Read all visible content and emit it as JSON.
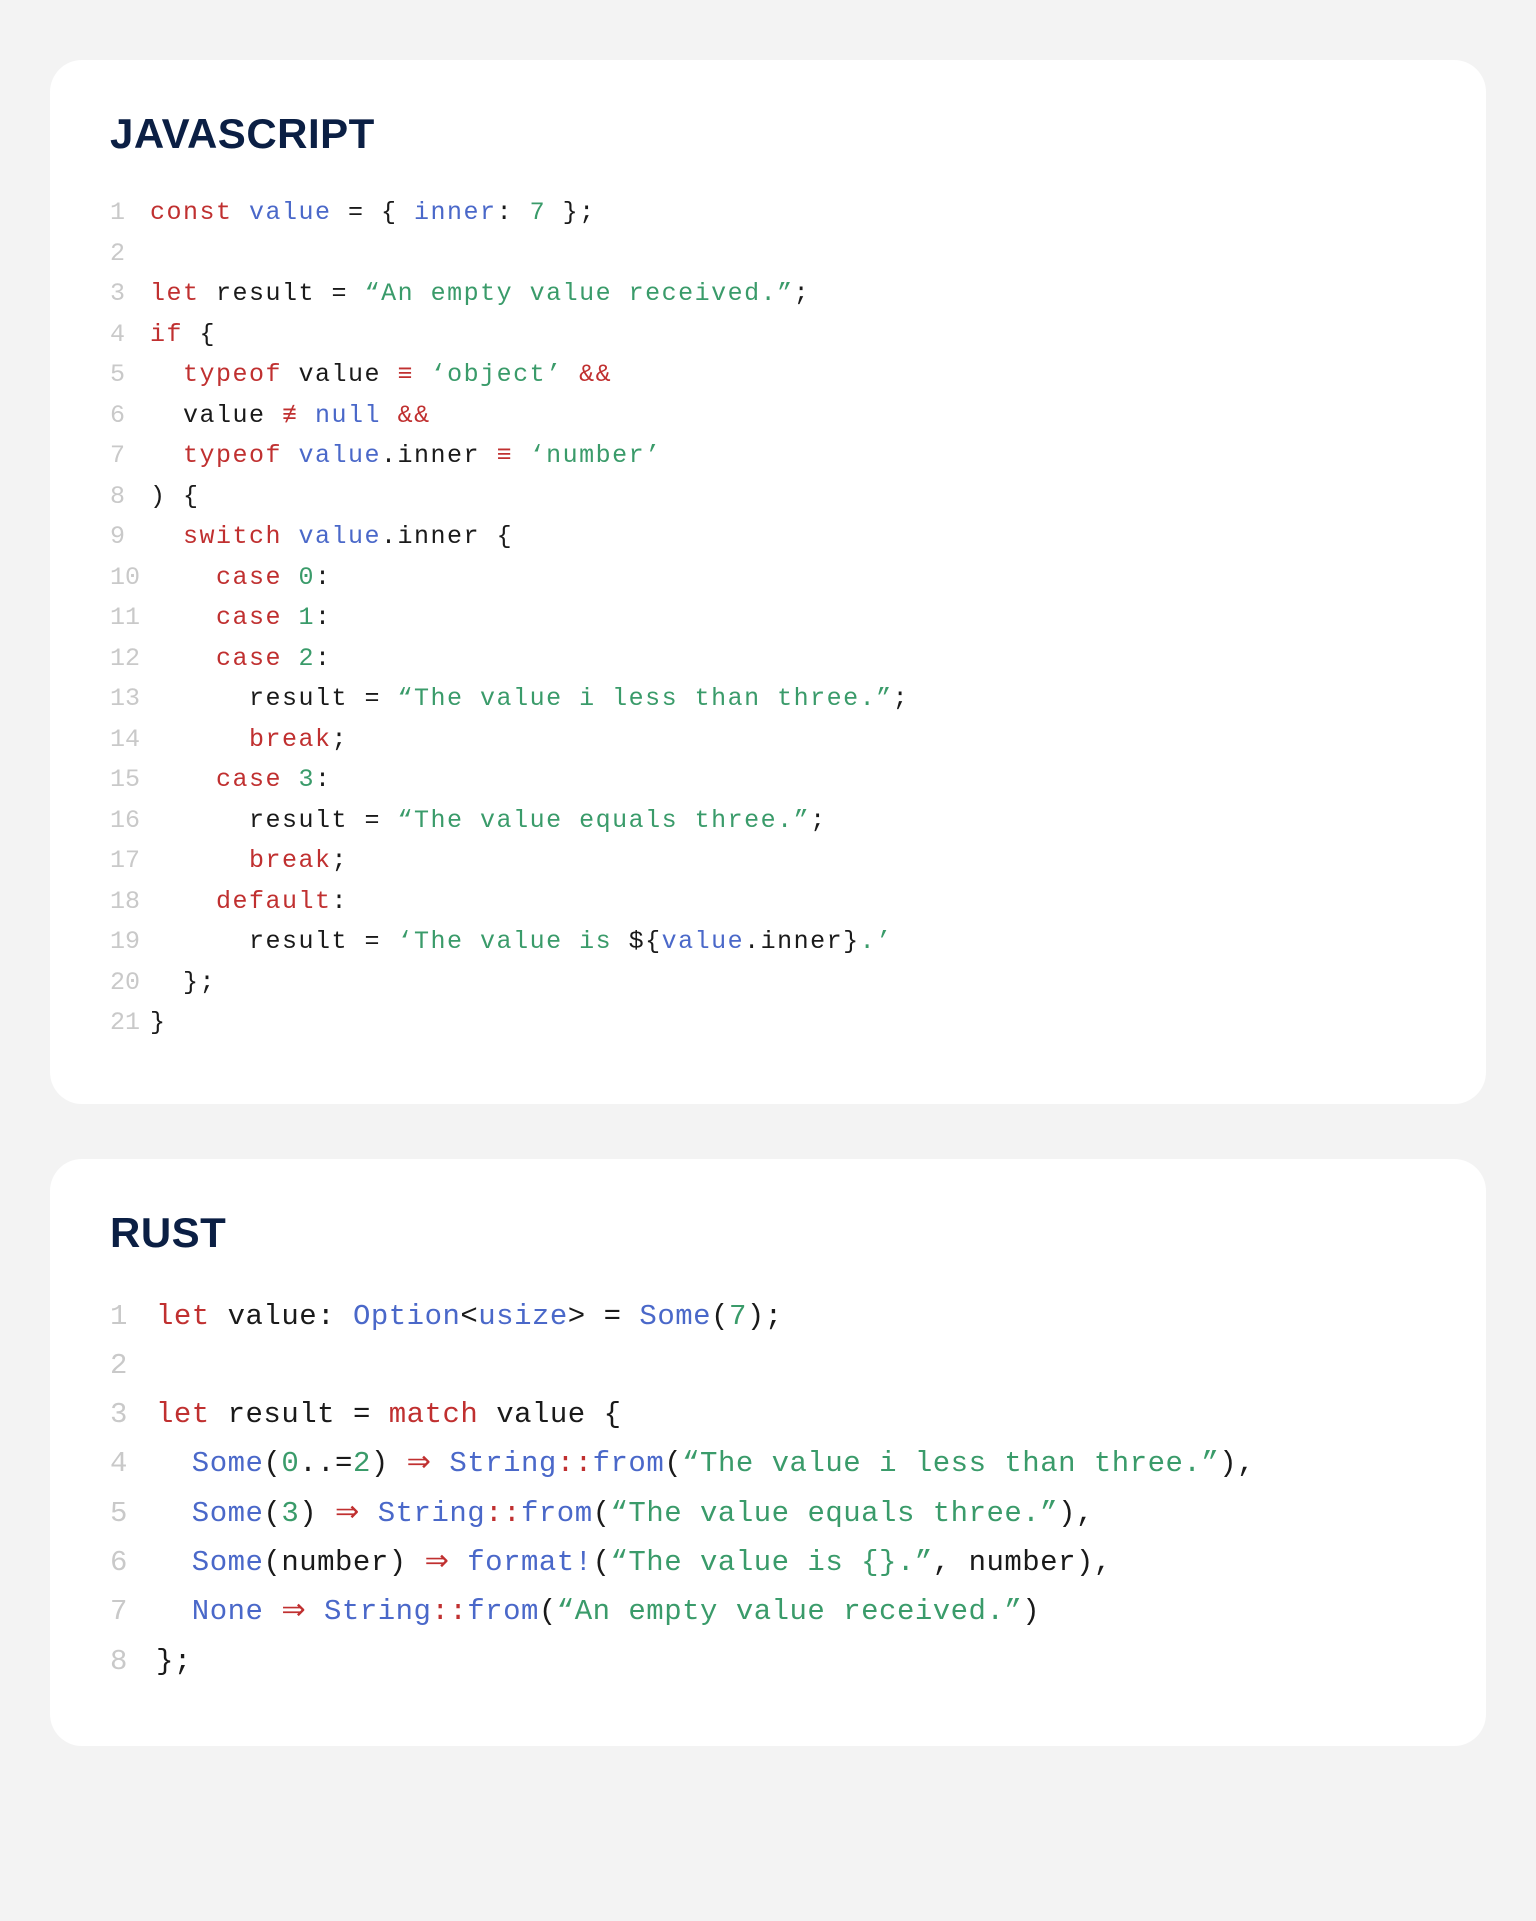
{
  "js": {
    "title": "JAVASCRIPT",
    "lines": {
      "1": {
        "n": "1",
        "a": "const ",
        "b": "value ",
        "c": "= { ",
        "d": "inner",
        "e": ": ",
        "f": "7",
        "g": " };"
      },
      "2": {
        "n": "2",
        "blank": " "
      },
      "3": {
        "n": "3",
        "a": "let ",
        "b": "result ",
        "c": "= ",
        "d": "“An empty value received.”",
        "e": ";"
      },
      "4": {
        "n": "4",
        "a": "if ",
        "b": "{"
      },
      "5": {
        "n": "5",
        "a": "  typeof ",
        "b": "value ",
        "c": "≡ ",
        "d": "‘object’ ",
        "e": "&&"
      },
      "6": {
        "n": "6",
        "a": "  value ",
        "b": "≢ ",
        "c": "null ",
        "d": "&&"
      },
      "7": {
        "n": "7",
        "a": "  typeof ",
        "b": "value",
        "c": ".inner ",
        "d": "≡ ",
        "e": "‘number’"
      },
      "8": {
        "n": "8",
        "a": ") {"
      },
      "9": {
        "n": "9",
        "a": "  switch ",
        "b": "value",
        "c": ".inner {"
      },
      "10": {
        "n": "10",
        "a": "    case ",
        "b": "0",
        "c": ":"
      },
      "11": {
        "n": "11",
        "a": "    case ",
        "b": "1",
        "c": ":"
      },
      "12": {
        "n": "12",
        "a": "    case ",
        "b": "2",
        "c": ":"
      },
      "13": {
        "n": "13",
        "a": "      result = ",
        "b": "“The value i less than three.”",
        "c": ";"
      },
      "14": {
        "n": "14",
        "a": "      break",
        "b": ";"
      },
      "15": {
        "n": "15",
        "a": "    case ",
        "b": "3",
        "c": ":"
      },
      "16": {
        "n": "16",
        "a": "      result = ",
        "b": "“The value equals three.”",
        "c": ";"
      },
      "17": {
        "n": "17",
        "a": "      break",
        "b": ";"
      },
      "18": {
        "n": "18",
        "a": "    default",
        "b": ":"
      },
      "19": {
        "n": "19",
        "a": "      result = ",
        "b": "‘The value is ",
        "c": "${",
        "d": "value",
        "e": ".inner",
        "f": "}",
        "g": ".’"
      },
      "20": {
        "n": "20",
        "a": "  };"
      },
      "21": {
        "n": "21",
        "a": "}"
      }
    }
  },
  "rust": {
    "title": "RUST",
    "lines": {
      "1": {
        "n": "1",
        "a": "let ",
        "b": "value: ",
        "c": "Option",
        "d": "<",
        "e": "usize",
        "f": "> = ",
        "g": "Some",
        "h": "(",
        "i": "7",
        "j": ");"
      },
      "2": {
        "n": "2",
        "blank": " "
      },
      "3": {
        "n": "3",
        "a": "let ",
        "b": "result = ",
        "c": "match ",
        "d": "value {"
      },
      "4": {
        "n": "4",
        "a": "  Some",
        "b": "(",
        "c": "0",
        "d": "..=",
        "e": "2",
        "f": ") ",
        "g": "⇒ ",
        "h": "String",
        "i": "::",
        "j": "from",
        "k": "(",
        "l": "“The value i less than three.”",
        "m": "),"
      },
      "5": {
        "n": "5",
        "a": "  Some",
        "b": "(",
        "c": "3",
        "d": ") ",
        "e": "⇒ ",
        "f": "String",
        "g": "::",
        "h": "from",
        "i": "(",
        "j": "“The value equals three.”",
        "k": "),"
      },
      "6": {
        "n": "6",
        "a": "  Some",
        "b": "(number) ",
        "c": "⇒ ",
        "d": "format!",
        "e": "(",
        "f": "“The value is {}.”",
        "g": ", number),"
      },
      "7": {
        "n": "7",
        "a": "  None ",
        "b": "⇒ ",
        "c": "String",
        "d": "::",
        "e": "from",
        "f": "(",
        "g": "“An empty value received.”",
        "h": ")"
      },
      "8": {
        "n": "8",
        "a": "};"
      }
    }
  }
}
